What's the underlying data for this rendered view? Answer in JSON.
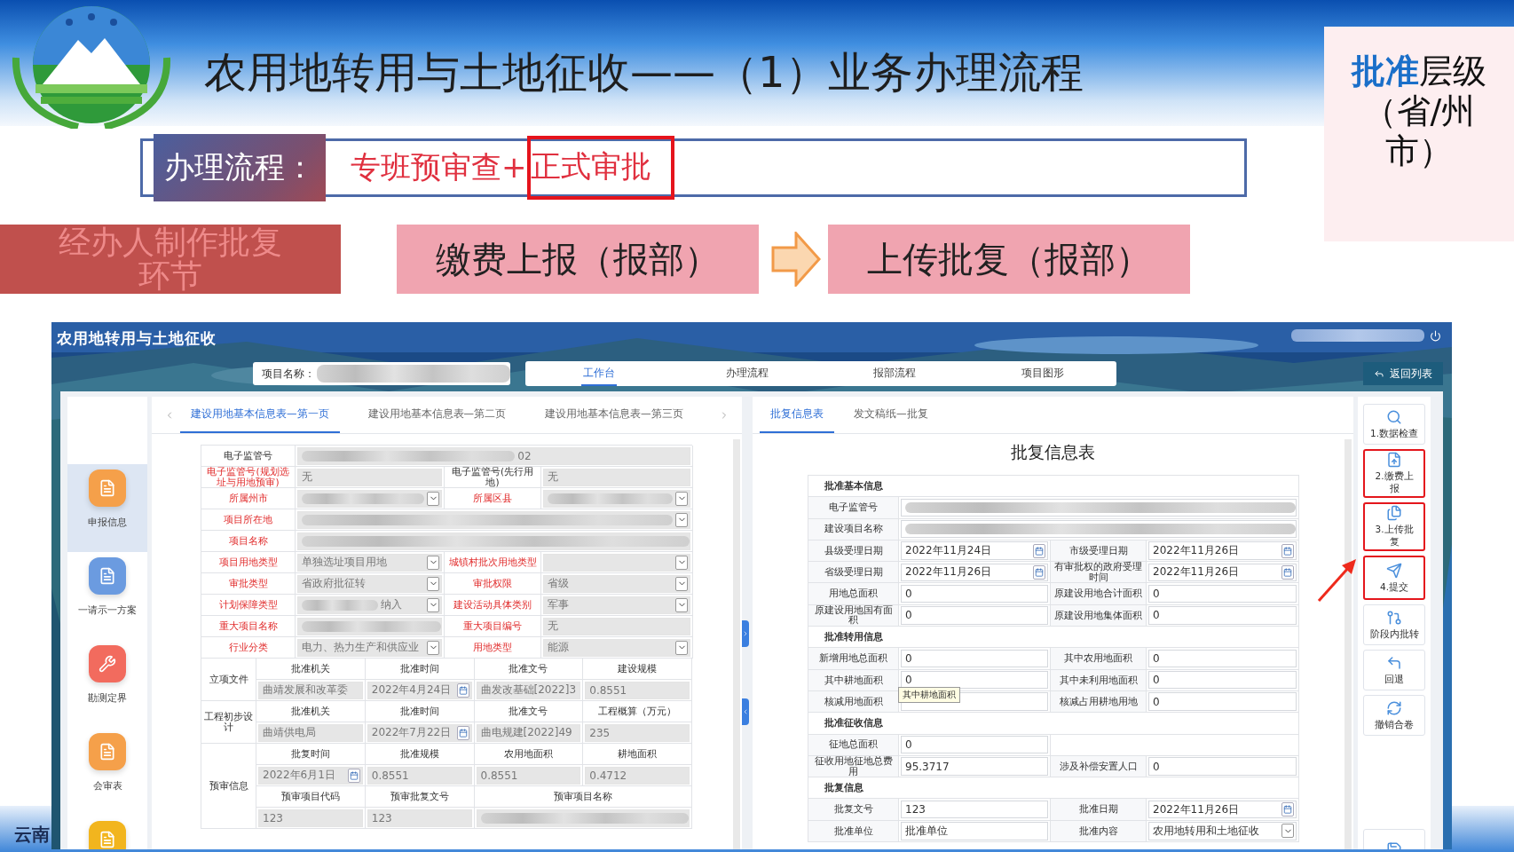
{
  "slide": {
    "title": "农用地转用与土地征收——（1）业务办理流程",
    "level_note": "**批准**层级（省/州市）",
    "flow": {
      "label": "办理流程：",
      "steps": [
        {
          "text": "专班预审查+",
          "boxed": false
        },
        {
          "text": "正式审批",
          "boxed": true
        }
      ]
    },
    "stages": [
      {
        "text": "经办人制作批复环节",
        "kind": "current"
      },
      {
        "text": "缴费上报（报部）",
        "kind": "step"
      },
      {
        "text": "上传批复（报部）",
        "kind": "step"
      }
    ],
    "footer": "云南"
  },
  "app": {
    "title": "农用地转用与土地征收",
    "project_label": "项目名称：",
    "back_button": "返回列表",
    "nav_tabs": [
      {
        "label": "工作台",
        "selected": true
      },
      {
        "label": "办理流程",
        "selected": false
      },
      {
        "label": "报部流程",
        "selected": false
      },
      {
        "label": "项目图形",
        "selected": false
      }
    ],
    "sidebar": [
      {
        "label": "申报信息",
        "color": "#f5a04a",
        "selected": true
      },
      {
        "label": "一请示一方案",
        "color": "#6b9be0",
        "selected": false
      },
      {
        "label": "勘测定界",
        "color": "#f26b5e",
        "selected": false
      },
      {
        "label": "会审表",
        "color": "#f5a04a",
        "selected": false
      },
      {
        "color": "#f2b51e",
        "selected": false
      }
    ],
    "left_tabs": [
      {
        "label": "建设用地基本信息表—第一页",
        "selected": true
      },
      {
        "label": "建设用地基本信息表—第二页",
        "selected": false
      },
      {
        "label": "建设用地基本信息表—第三页",
        "selected": false
      }
    ],
    "left_form": {
      "readonly": true,
      "rows": [
        [
          {
            "kind": "label",
            "text": "电子监管号",
            "alert": false
          },
          {
            "kind": "text",
            "blurred": true,
            "value": "02",
            "wide": true
          }
        ],
        [
          {
            "kind": "label",
            "text": "电子监管号(规划选址与用地预审)",
            "alert": true
          },
          {
            "kind": "text",
            "value": "无"
          },
          {
            "kind": "label",
            "text": "电子监管号(先行用地)",
            "alert": false
          },
          {
            "kind": "text",
            "value": "无"
          }
        ],
        [
          {
            "kind": "label",
            "text": "所属州市",
            "alert": true
          },
          {
            "kind": "select",
            "blurred": true
          },
          {
            "kind": "label",
            "text": "所属区县",
            "alert": true
          },
          {
            "kind": "select",
            "blurred": true
          }
        ],
        [
          {
            "kind": "label",
            "text": "项目所在地",
            "alert": true
          },
          {
            "kind": "select",
            "blurred": true,
            "wide": true
          }
        ],
        [
          {
            "kind": "label",
            "text": "项目名称",
            "alert": true
          },
          {
            "kind": "text",
            "blurred": true,
            "wide": true
          }
        ],
        [
          {
            "kind": "label",
            "text": "项目用地类型",
            "alert": true
          },
          {
            "kind": "select",
            "value": "单独选址项目用地"
          },
          {
            "kind": "label",
            "text": "城镇村批次用地类型",
            "alert": true
          },
          {
            "kind": "select"
          }
        ],
        [
          {
            "kind": "label",
            "text": "审批类型",
            "alert": true
          },
          {
            "kind": "select",
            "value": "省政府批征转"
          },
          {
            "kind": "label",
            "text": "审批权限",
            "alert": true
          },
          {
            "kind": "select",
            "value": "省级"
          }
        ],
        [
          {
            "kind": "label",
            "text": "计划保障类型",
            "alert": true
          },
          {
            "kind": "select",
            "value": "纳入",
            "blurred": true
          },
          {
            "kind": "label",
            "text": "建设活动具体类别",
            "alert": true
          },
          {
            "kind": "select",
            "value": "军事"
          }
        ],
        [
          {
            "kind": "label",
            "text": "重大项目名称",
            "alert": true
          },
          {
            "kind": "text",
            "blurred": true
          },
          {
            "kind": "label",
            "text": "重大项目编号",
            "alert": true
          },
          {
            "kind": "text",
            "value": "无"
          }
        ],
        [
          {
            "kind": "label",
            "text": "行业分类",
            "alert": true
          },
          {
            "kind": "select",
            "value": "电力、热力生产和供应业"
          },
          {
            "kind": "label",
            "text": "用地类型",
            "alert": true
          },
          {
            "kind": "select",
            "value": "能源"
          }
        ]
      ],
      "groups": [
        {
          "label": "立项文件",
          "rows": [
            [
              {
                "kind": "header",
                "text": "批准机关"
              },
              {
                "kind": "header",
                "text": "批准时间"
              },
              {
                "kind": "header",
                "text": "批准文号"
              },
              {
                "kind": "header",
                "text": "建设规模"
              }
            ],
            [
              {
                "kind": "text",
                "value": "曲靖发展和改革委"
              },
              {
                "kind": "date",
                "value": "2022年4月24日"
              },
              {
                "kind": "text",
                "value": "曲发改基础[2022]3"
              },
              {
                "kind": "text",
                "value": "0.8551"
              }
            ]
          ]
        },
        {
          "label": "工程初步设计",
          "rows": [
            [
              {
                "kind": "header",
                "text": "批准机关"
              },
              {
                "kind": "header",
                "text": "批准时间"
              },
              {
                "kind": "header",
                "text": "批准文号"
              },
              {
                "kind": "header",
                "text": "工程概算（万元）"
              }
            ],
            [
              {
                "kind": "text",
                "value": "曲靖供电局"
              },
              {
                "kind": "date",
                "value": "2022年7月22日"
              },
              {
                "kind": "text",
                "value": "曲电规建[2022]49"
              },
              {
                "kind": "text",
                "value": "235"
              }
            ]
          ]
        },
        {
          "label": "预审信息",
          "rows": [
            [
              {
                "kind": "header",
                "text": "批复时间"
              },
              {
                "kind": "header",
                "text": "批准规模"
              },
              {
                "kind": "header",
                "text": "农用地面积"
              },
              {
                "kind": "header",
                "text": "耕地面积"
              }
            ],
            [
              {
                "kind": "date",
                "value": "2022年6月1日"
              },
              {
                "kind": "text",
                "value": "0.8551"
              },
              {
                "kind": "text",
                "value": "0.8551"
              },
              {
                "kind": "text",
                "value": "0.4712"
              }
            ],
            [
              {
                "kind": "header",
                "text": "预审项目代码"
              },
              {
                "kind": "header",
                "text": "预审批复文号"
              },
              {
                "kind": "header",
                "text": "预审项目名称",
                "wide": true
              }
            ],
            [
              {
                "kind": "text",
                "value": "123"
              },
              {
                "kind": "text",
                "value": "123"
              },
              {
                "kind": "text",
                "blurred": true,
                "wide": true
              }
            ]
          ]
        }
      ]
    },
    "right_tabs": [
      {
        "label": "批复信息表",
        "selected": true
      },
      {
        "label": "发文稿纸—批复",
        "selected": false
      }
    ],
    "right_form": {
      "title": "批复信息表",
      "readonly": false,
      "sections": [
        {
          "title": "批准基本信息",
          "rows": [
            [
              {
                "kind": "label",
                "text": "电子监管号",
                "alert": false
              },
              {
                "kind": "text",
                "blurred": true,
                "wide": true
              }
            ],
            [
              {
                "kind": "label",
                "text": "建设项目名称",
                "alert": false
              },
              {
                "kind": "text",
                "blurred": true,
                "wide": true
              }
            ],
            [
              {
                "kind": "label",
                "text": "县级受理日期",
                "alert": false
              },
              {
                "kind": "date",
                "value": "2022年11月24日"
              },
              {
                "kind": "label",
                "text": "市级受理日期",
                "alert": false
              },
              {
                "kind": "date",
                "value": "2022年11月26日"
              }
            ],
            [
              {
                "kind": "label",
                "text": "省级受理日期",
                "alert": false
              },
              {
                "kind": "date",
                "value": "2022年11月26日"
              },
              {
                "kind": "label",
                "text": "有审批权的政府受理时间",
                "alert": false
              },
              {
                "kind": "date",
                "value": "2022年11月26日"
              }
            ],
            [
              {
                "kind": "label",
                "text": "用地总面积",
                "alert": false
              },
              {
                "kind": "text",
                "value": "0"
              },
              {
                "kind": "label",
                "text": "原建设用地合计面积",
                "alert": false
              },
              {
                "kind": "text",
                "value": "0"
              }
            ],
            [
              {
                "kind": "label",
                "text": "原建设用地国有面积",
                "alert": false
              },
              {
                "kind": "text",
                "value": "0"
              },
              {
                "kind": "label",
                "text": "原建设用地集体面积",
                "alert": false
              },
              {
                "kind": "text",
                "value": "0"
              }
            ]
          ]
        },
        {
          "title": "批准转用信息",
          "rows": [
            [
              {
                "kind": "label",
                "text": "新增用地总面积",
                "alert": false
              },
              {
                "kind": "text",
                "value": "0"
              },
              {
                "kind": "label",
                "text": "其中农用地面积",
                "alert": false
              },
              {
                "kind": "text",
                "value": "0"
              }
            ],
            [
              {
                "kind": "label",
                "text": "其中耕地面积",
                "alert": false
              },
              {
                "kind": "text",
                "value": "0",
                "tooltip": "其中耕地面积"
              },
              {
                "kind": "label",
                "text": "其中未利用地面积",
                "alert": false
              },
              {
                "kind": "text",
                "value": "0"
              }
            ],
            [
              {
                "kind": "label",
                "text": "核减用地面积",
                "alert": false
              },
              {
                "kind": "text"
              },
              {
                "kind": "label",
                "text": "核减占用耕地用地",
                "alert": false
              },
              {
                "kind": "text",
                "value": "0"
              }
            ]
          ]
        },
        {
          "title": "批准征收信息",
          "rows": [
            [
              {
                "kind": "label",
                "text": "征地总面积",
                "alert": false
              },
              {
                "kind": "text",
                "value": "0"
              },
              {
                "kind": "empty",
                "wide": true
              }
            ],
            [
              {
                "kind": "label",
                "text": "征收用地征地总费用",
                "alert": false
              },
              {
                "kind": "text",
                "value": "95.3717"
              },
              {
                "kind": "label",
                "text": "涉及补偿安置人口",
                "alert": false
              },
              {
                "kind": "text",
                "value": "0"
              }
            ]
          ]
        },
        {
          "title": "批复信息",
          "rows": [
            [
              {
                "kind": "label",
                "text": "批复文号",
                "alert": false
              },
              {
                "kind": "text",
                "value": "123"
              },
              {
                "kind": "label",
                "text": "批准日期",
                "alert": false
              },
              {
                "kind": "date",
                "value": "2022年11月26日"
              }
            ],
            [
              {
                "kind": "label",
                "text": "批准单位",
                "alert": false
              },
              {
                "kind": "text",
                "value": "批准单位"
              },
              {
                "kind": "label",
                "text": "批准内容",
                "alert": false
              },
              {
                "kind": "select",
                "value": "农用地转用和土地征收"
              }
            ]
          ]
        }
      ]
    },
    "actions": [
      {
        "label": "1.数据检查",
        "highlighted": false
      },
      {
        "label": "2.缴费上报",
        "highlighted": true
      },
      {
        "label": "3.上传批复",
        "highlighted": true
      },
      {
        "label": "4.提交",
        "highlighted": true
      },
      {
        "label": "阶段内批转",
        "highlighted": false
      },
      {
        "label": "回退",
        "highlighted": false
      },
      {
        "label": "撤销合卷",
        "highlighted": false
      },
      {
        "highlighted": false
      }
    ]
  }
}
